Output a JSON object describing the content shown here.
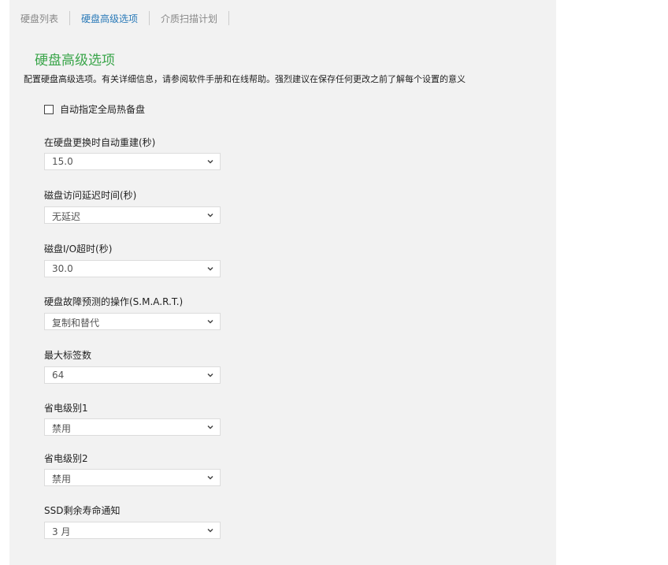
{
  "tabs": [
    {
      "label": "硬盘列表",
      "active": false
    },
    {
      "label": "硬盘高级选项",
      "active": true
    },
    {
      "label": "介质扫描计划",
      "active": false
    }
  ],
  "page": {
    "title": "硬盘高级选项",
    "description": "配置硬盘高级选项。有关详细信息，请参阅软件手册和在线帮助。强烈建议在保存任何更改之前了解每个设置的意义",
    "global_hot_spare_label": "自动指定全局热备盘",
    "global_hot_spare_checked": false
  },
  "fields": [
    {
      "label": "在硬盘更换时自动重建(秒)",
      "value": "15.0"
    },
    {
      "label": "磁盘访问延迟时间(秒)",
      "value": "无延迟"
    },
    {
      "label": "磁盘I/O超时(秒)",
      "value": "30.0"
    },
    {
      "label": "硬盘故障预测的操作(S.M.A.R.T.)",
      "value": "复制和替代"
    },
    {
      "label": "最大标签数",
      "value": "64"
    },
    {
      "label": "省电级别1",
      "value": "禁用"
    },
    {
      "label": "省电级别2",
      "value": "禁用"
    },
    {
      "label": "SSD剩余寿命通知",
      "value": "3 月"
    }
  ],
  "colors": {
    "accent_tab": "#2a7ab8",
    "title_green": "#3aa54a",
    "panel_bg": "#f2f2f2"
  },
  "icons": {
    "dropdown": "chevron-down-icon"
  }
}
